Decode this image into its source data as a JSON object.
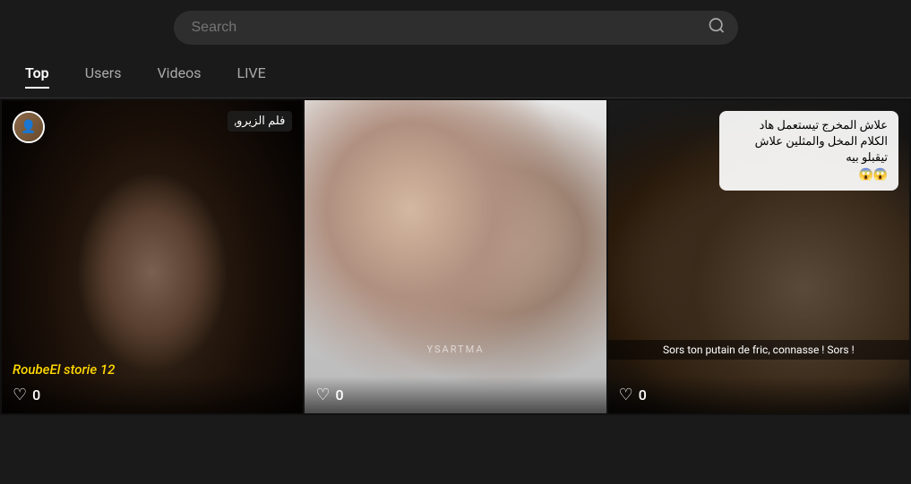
{
  "header": {
    "search_placeholder": "Search"
  },
  "tabs": {
    "items": [
      {
        "label": "Top",
        "active": true
      },
      {
        "label": "Users",
        "active": false
      },
      {
        "label": "Videos",
        "active": false
      },
      {
        "label": "LIVE",
        "active": false
      }
    ]
  },
  "videos": [
    {
      "id": 1,
      "has_avatar": true,
      "arabic_title": "فلم الزيرو,",
      "main_title": "RoubeEl storie 12",
      "likes": "0",
      "subtitle": null
    },
    {
      "id": 2,
      "has_avatar": false,
      "watermark": "YSARTMA",
      "likes": "0",
      "subtitle": null
    },
    {
      "id": 3,
      "has_avatar": false,
      "overlay_text": "علاش المخرج تيستعمل هاد الكلام المخل والمثلين علاش تيقبلو بيه\n😱😱",
      "subtitle": "Sors ton putain de fric, connasse ! Sors !",
      "likes": "0"
    }
  ],
  "icons": {
    "search": "🔍",
    "heart": "♡"
  }
}
